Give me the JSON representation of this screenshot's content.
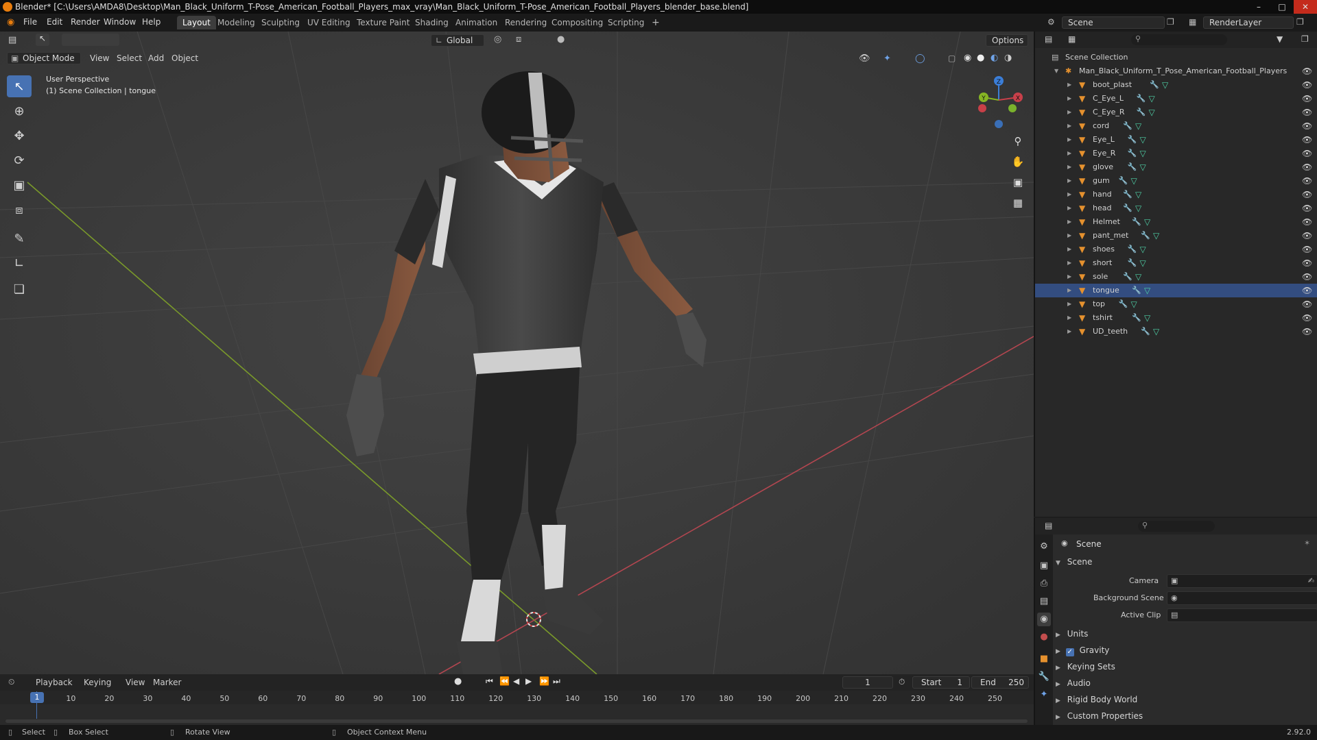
{
  "window": {
    "title": "Blender* [C:\\Users\\AMDA8\\Desktop\\Man_Black_Uniform_T-Pose_American_Football_Players_max_vray\\Man_Black_Uniform_T-Pose_American_Football_Players_blender_base.blend]",
    "minimize": "–",
    "maximize": "□",
    "close": "✕"
  },
  "menu": {
    "file": "File",
    "edit": "Edit",
    "render": "Render",
    "window": "Window",
    "help": "Help"
  },
  "workspaces": [
    "Layout",
    "Modeling",
    "Sculpting",
    "UV Editing",
    "Texture Paint",
    "Shading",
    "Animation",
    "Rendering",
    "Compositing",
    "Scripting"
  ],
  "workspace_add": "+",
  "scene_selector": {
    "value": "Scene"
  },
  "render_layer": {
    "value": "RenderLayer"
  },
  "viewport": {
    "transform_orientation": "Global",
    "options": "Options",
    "mode": "Object Mode",
    "menus": [
      "View",
      "Select",
      "Add",
      "Object"
    ],
    "overlay_line1": "User Perspective",
    "overlay_line2": "(1) Scene Collection | tongue",
    "gizmo": {
      "z": "Z",
      "y": "Y",
      "x": "X"
    }
  },
  "outliner": {
    "root": "Scene Collection",
    "collection": "Man_Black_Uniform_T_Pose_American_Football_Players",
    "objects": [
      "boot_plast",
      "C_Eye_L",
      "C_Eye_R",
      "cord",
      "Eye_L",
      "Eye_R",
      "glove",
      "gum",
      "hand",
      "head",
      "Helmet",
      "pant_met",
      "shoes",
      "short",
      "sole",
      "tongue",
      "top",
      "tshirt",
      "UD_teeth"
    ]
  },
  "properties": {
    "context": "Scene",
    "panel_scene": "Scene",
    "camera_label": "Camera",
    "background_label": "Background Scene",
    "clip_label": "Active Clip",
    "panels": [
      "Units",
      "Gravity",
      "Keying Sets",
      "Audio",
      "Rigid Body World",
      "Custom Properties"
    ],
    "gravity_checked": true
  },
  "timeline": {
    "menus": [
      "Playback",
      "Keying",
      "View",
      "Marker"
    ],
    "current_frame": "1",
    "start_label": "Start",
    "start": "1",
    "end_label": "End",
    "end": "250",
    "frames": [
      "1",
      "10",
      "20",
      "30",
      "40",
      "50",
      "60",
      "70",
      "80",
      "90",
      "100",
      "110",
      "120",
      "130",
      "140",
      "150",
      "160",
      "170",
      "180",
      "190",
      "200",
      "210",
      "220",
      "230",
      "240",
      "250"
    ]
  },
  "status": {
    "select": "Select",
    "box_select": "Box Select",
    "rotate_view": "Rotate View",
    "context_menu": "Object Context Menu",
    "version": "2.92.0"
  },
  "colors": {
    "accent": "#4772b3",
    "object_orange": "#e5912e",
    "x_axis": "#c8404a",
    "y_axis": "#86b524",
    "z_axis": "#3b7ed8"
  }
}
